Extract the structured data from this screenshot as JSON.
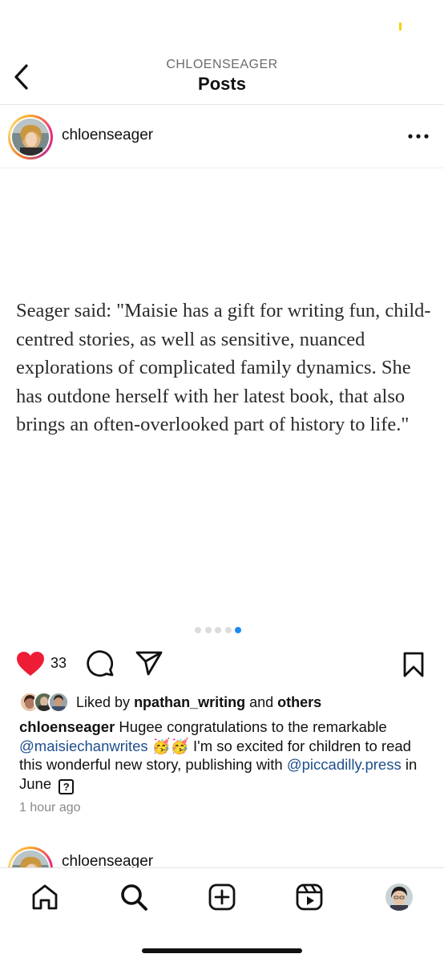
{
  "header": {
    "subtitle": "CHLOENSEAGER",
    "title": "Posts"
  },
  "post": {
    "username": "chloenseager",
    "quote": "Seager said: \"Maisie has a gift for writing fun, child-centred stories, as well as sensitive, nuanced explorations of complicated family dynamics. She has outdone herself with her latest book, that also brings an often-overlooked part of history to life.\"",
    "carousel": {
      "total": 5,
      "active_index": 4
    },
    "like_count": "33",
    "likes": {
      "prefix": "Liked by",
      "user": "npathan_writing",
      "joiner": "and",
      "others": "others"
    },
    "caption": {
      "username": "chloenseager",
      "text_1": " Hugee congratulations to the remarkable ",
      "mention_1": "@maisiechanwrites",
      "emoji": " 🥳🥳 ",
      "text_2": "I'm so excited for children to read this wonderful new story, publishing with ",
      "mention_2": "@piccadilly.press",
      "text_3": " in June ",
      "unknown_glyph": "?"
    },
    "timestamp": "1 hour ago",
    "liked": true
  },
  "next_post": {
    "username": "chloenseager"
  },
  "colors": {
    "like_red": "#ee1d36",
    "mention_blue": "#1e4e8c",
    "carousel_active": "#1d8cf0",
    "status_yellow": "#f5cf00"
  },
  "icons": [
    "back-icon",
    "more-icon",
    "heart-icon",
    "comment-icon",
    "share-icon",
    "bookmark-icon",
    "home-icon",
    "search-icon",
    "create-icon",
    "reels-icon"
  ]
}
